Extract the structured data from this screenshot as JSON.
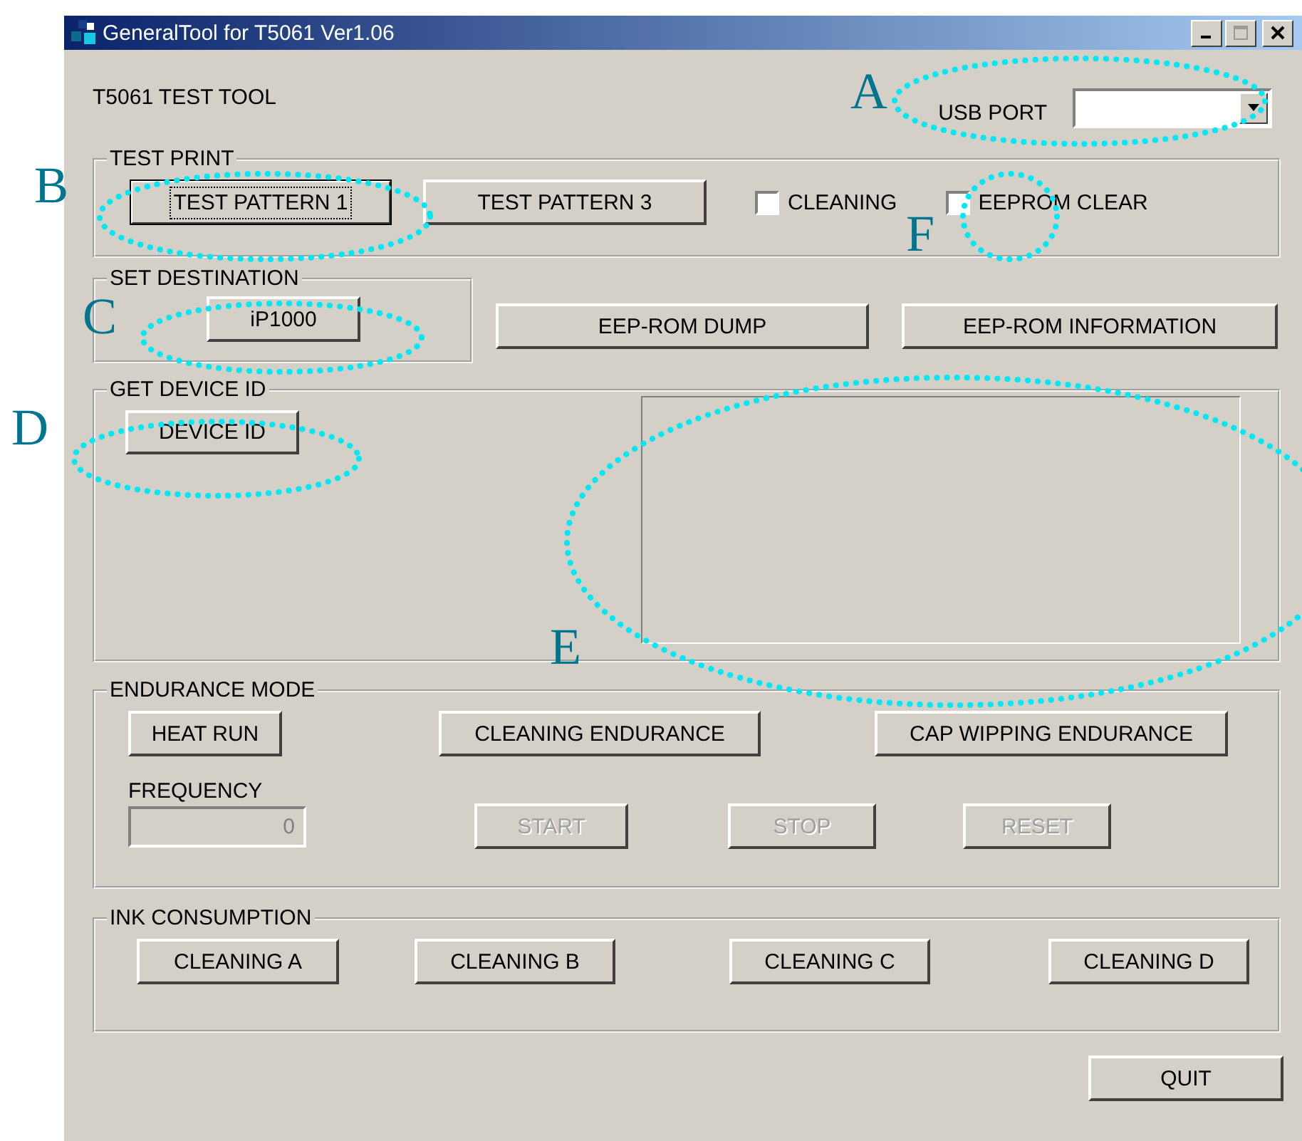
{
  "window": {
    "title": "GeneralTool for T5061 Ver1.06"
  },
  "header": {
    "title": "T5061 TEST TOOL",
    "usb_port_label": "USB PORT"
  },
  "test_print": {
    "title": "TEST PRINT",
    "buttons": [
      {
        "label": "TEST PATTERN 1",
        "focused": true
      },
      {
        "label": "TEST PATTERN 3",
        "focused": false
      }
    ],
    "checkboxes": [
      {
        "label": "CLEANING",
        "checked": false
      },
      {
        "label": "EEPROM CLEAR",
        "checked": false
      }
    ]
  },
  "set_destination": {
    "title": "SET DESTINATION",
    "button": "iP1000"
  },
  "eeprom_buttons": [
    "EEP-ROM DUMP",
    "EEP-ROM INFORMATION"
  ],
  "get_device_id": {
    "title": "GET DEVICE ID",
    "button": "DEVICE ID"
  },
  "endurance_mode": {
    "title": "ENDURANCE MODE",
    "buttons": [
      "HEAT RUN",
      "CLEANING ENDURANCE",
      "CAP WIPPING ENDURANCE"
    ],
    "frequency_label": "FREQUENCY",
    "frequency_value": "0",
    "frequency_disabled": true,
    "controls": [
      {
        "label": "START",
        "disabled": true
      },
      {
        "label": "STOP",
        "disabled": true
      },
      {
        "label": "RESET",
        "disabled": true
      }
    ]
  },
  "ink_consumption": {
    "title": "INK CONSUMPTION",
    "buttons": [
      "CLEANING A",
      "CLEANING B",
      "CLEANING C",
      "CLEANING D"
    ]
  },
  "quit_button": "QUIT",
  "annotations": [
    {
      "label": "A"
    },
    {
      "label": "B"
    },
    {
      "label": "C"
    },
    {
      "label": "D"
    },
    {
      "label": "E"
    },
    {
      "label": "F"
    }
  ]
}
